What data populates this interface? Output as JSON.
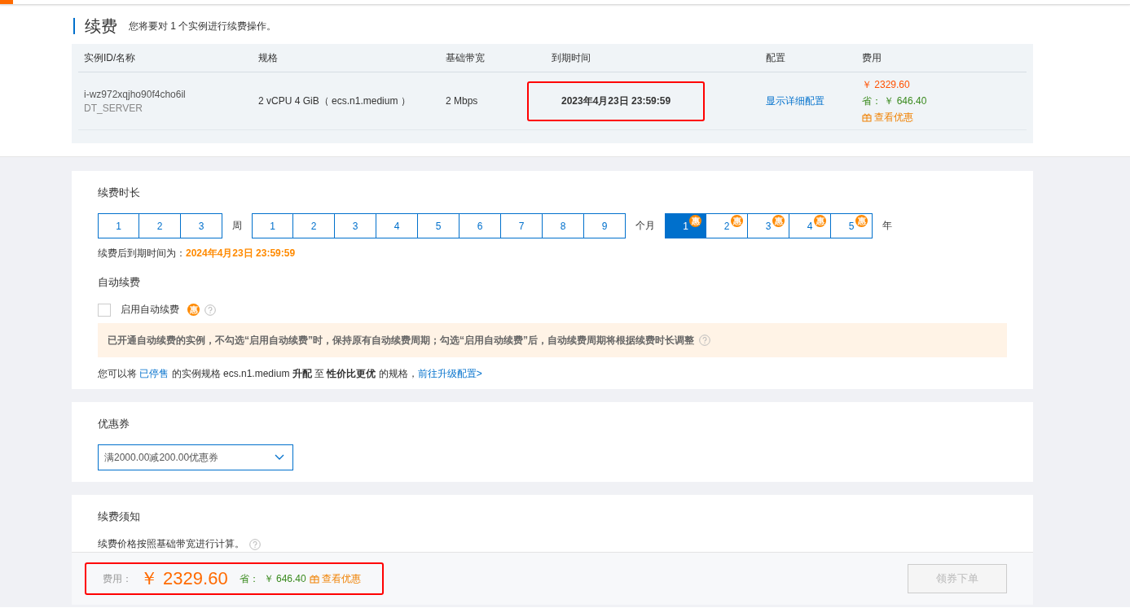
{
  "header": {
    "title": "续费",
    "subtitle": "您将要对 1 个实例进行续费操作。"
  },
  "table": {
    "columns": [
      "实例ID/名称",
      "规格",
      "基础带宽",
      "到期时间",
      "配置",
      "费用"
    ],
    "rows": [
      {
        "id": "i-wz972xqjho90f4cho6il",
        "name": "DT_SERVER",
        "spec": "2 vCPU 4 GiB（ ecs.n1.medium ）",
        "bandwidth": "2 Mbps",
        "expiry": "2023年4月23日 23:59:59",
        "highlighted": true,
        "config_link": "显示详细配置",
        "price": "￥ 2329.60",
        "saving_label": "省：",
        "saving": "￥ 646.40",
        "offers": "查看优惠"
      }
    ]
  },
  "duration": {
    "title": "续费时长",
    "groups": [
      {
        "unit": "周",
        "options": [
          {
            "label": "1",
            "selected": false
          },
          {
            "label": "2",
            "selected": false
          },
          {
            "label": "3",
            "selected": false
          }
        ]
      },
      {
        "unit": "个月",
        "options": [
          {
            "label": "1",
            "selected": false
          },
          {
            "label": "2",
            "selected": false
          },
          {
            "label": "3",
            "selected": false
          },
          {
            "label": "4",
            "selected": false
          },
          {
            "label": "5",
            "selected": false
          },
          {
            "label": "6",
            "selected": false
          },
          {
            "label": "7",
            "selected": false
          },
          {
            "label": "8",
            "selected": false
          },
          {
            "label": "9",
            "selected": false
          }
        ]
      },
      {
        "unit": "年",
        "options": [
          {
            "label": "1",
            "selected": true,
            "badge": "惠"
          },
          {
            "label": "2",
            "selected": false,
            "badge": "惠"
          },
          {
            "label": "3",
            "selected": false,
            "badge": "惠"
          },
          {
            "label": "4",
            "selected": false,
            "badge": "惠"
          },
          {
            "label": "5",
            "selected": false,
            "badge": "惠"
          }
        ]
      }
    ],
    "expiry_label": "续费后到期时间为：",
    "expiry_value": "2024年4月23日 23:59:59"
  },
  "auto_renew": {
    "title": "自动续费",
    "checkbox": {
      "label": "启用自动续费",
      "checked": false,
      "badge": "惠"
    },
    "notice": "已开通自动续费的实例，不勾选“启用自动续费”时，保持原有自动续费周期；勾选“启用自动续费”后，自动续费周期将根据续费时长调整",
    "upgrade": [
      {
        "kind": "text",
        "text": "您可以将 "
      },
      {
        "kind": "link",
        "text": "已停售"
      },
      {
        "kind": "text",
        "text": " 的实例规格 ecs.n1.medium **升配** 至 **性价比更优** 的规格，"
      },
      {
        "kind": "link",
        "text": "前往升级配置>"
      }
    ]
  },
  "coupon": {
    "title": "优惠券",
    "value": "满2000.00减200.00优惠券"
  },
  "renewal_notice": {
    "title": "续费须知",
    "text": "续费价格按照基础带宽进行计算。"
  },
  "footer": {
    "label": "费用：",
    "total": "￥ 2329.60",
    "highlighted": true,
    "saving_label": "省：",
    "saving": "￥ 646.40",
    "offers": "查看优惠",
    "button": "领券下单",
    "button_disabled": true
  }
}
